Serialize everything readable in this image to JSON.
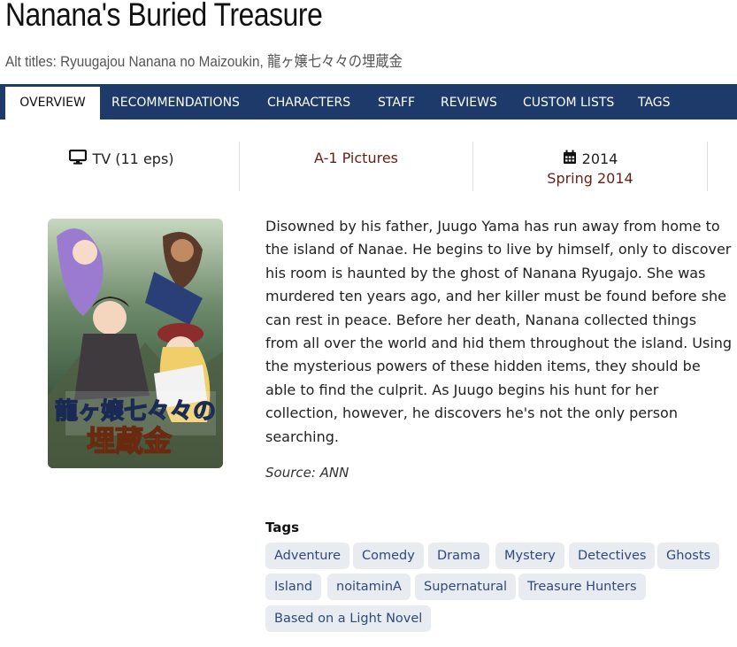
{
  "page": {
    "title": "Nanana's Buried Treasure",
    "alt_titles": "Alt titles: Ryuugajou Nanana no Maizoukin, 龍ヶ嬢七々々の埋蔵金"
  },
  "nav": {
    "tabs": [
      {
        "label": "OVERVIEW",
        "active": true
      },
      {
        "label": "RECOMMENDATIONS"
      },
      {
        "label": "CHARACTERS"
      },
      {
        "label": "STAFF"
      },
      {
        "label": "REVIEWS"
      },
      {
        "label": "CUSTOM LISTS"
      },
      {
        "label": "TAGS"
      }
    ]
  },
  "info": {
    "type": "TV (11 eps)",
    "studio": "A-1 Pictures",
    "year": "2014",
    "season": "Spring 2014"
  },
  "synopsis": "Disowned by his father, Juugo Yama has run away from home to the island of Nanae. He begins to live by himself, only to discover his room is haunted by the ghost of Nanana Ryugajo. She was murdered ten years ago, and her killer must be found before she can rest in peace. Before her death, Nanana collected things from all over the world and hid them throughout the island. Using the mysterious powers of these hidden items, they should be able to find the culprit. As Juugo begins his hunt for her collection, however, he discovers he's not the only person searching.",
  "source": "Source: ANN",
  "tags": {
    "title": "Tags",
    "items": [
      "Adventure",
      "Comedy",
      "Drama",
      "Mystery",
      "Detectives",
      "Ghosts",
      "Island",
      "noitaminA",
      "Supernatural",
      "Treasure Hunters",
      "Based on a Light Novel"
    ]
  },
  "poster": {
    "logo_line1": "龍ヶ嬢七々々の",
    "logo_line2": "埋蔵金"
  },
  "icons": {
    "type_icon": "monitor-icon",
    "date_icon": "calendar-icon"
  },
  "colors": {
    "nav_bg": "#1d3a6b",
    "link": "#6a1f14",
    "tag_bg": "#e8ecf1",
    "tag_text": "#2e4a7a"
  }
}
